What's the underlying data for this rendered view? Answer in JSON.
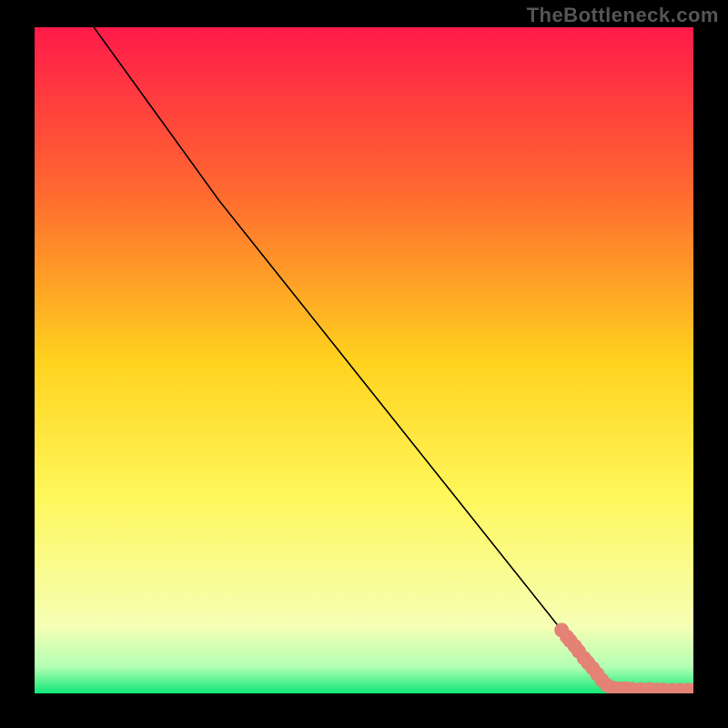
{
  "watermark": "TheBottleneck.com",
  "chart_data": {
    "type": "line",
    "title": "",
    "xlabel": "",
    "ylabel": "",
    "xlim": [
      0,
      100
    ],
    "ylim": [
      0,
      100
    ],
    "grid": false,
    "background_gradient": {
      "stops": [
        {
          "offset": 0.0,
          "color": "#ff1a4a"
        },
        {
          "offset": 0.25,
          "color": "#ff6a2f"
        },
        {
          "offset": 0.5,
          "color": "#ffd21e"
        },
        {
          "offset": 0.7,
          "color": "#fff75a"
        },
        {
          "offset": 0.9,
          "color": "#f5ffb5"
        },
        {
          "offset": 0.96,
          "color": "#b3ffb3"
        },
        {
          "offset": 1.0,
          "color": "#10e878"
        }
      ]
    },
    "curve": {
      "name": "bottleneck-curve",
      "color": "#000000",
      "points": [
        {
          "x": 9,
          "y": 100
        },
        {
          "x": 28,
          "y": 74
        },
        {
          "x": 87,
          "y": 0.8
        },
        {
          "x": 100,
          "y": 0.5
        }
      ]
    },
    "markers": {
      "name": "data-points",
      "color": "#e38275",
      "radius": 1.1,
      "points": [
        {
          "x": 80.0,
          "y": 9.5
        },
        {
          "x": 80.8,
          "y": 8.5
        },
        {
          "x": 81.3,
          "y": 7.9
        },
        {
          "x": 82.0,
          "y": 7.1
        },
        {
          "x": 82.6,
          "y": 6.3
        },
        {
          "x": 83.4,
          "y": 5.3
        },
        {
          "x": 84.0,
          "y": 4.6
        },
        {
          "x": 84.7,
          "y": 3.8
        },
        {
          "x": 85.4,
          "y": 2.9
        },
        {
          "x": 86.1,
          "y": 2.0
        },
        {
          "x": 86.9,
          "y": 1.2
        },
        {
          "x": 87.8,
          "y": 0.8
        },
        {
          "x": 88.8,
          "y": 0.7
        },
        {
          "x": 89.7,
          "y": 0.7
        },
        {
          "x": 90.7,
          "y": 0.65
        },
        {
          "x": 92.0,
          "y": 0.6
        },
        {
          "x": 93.3,
          "y": 0.6
        },
        {
          "x": 94.4,
          "y": 0.55
        },
        {
          "x": 95.5,
          "y": 0.55
        },
        {
          "x": 96.8,
          "y": 0.5
        },
        {
          "x": 98.0,
          "y": 0.5
        },
        {
          "x": 99.2,
          "y": 0.5
        },
        {
          "x": 100.0,
          "y": 0.5
        }
      ]
    }
  }
}
